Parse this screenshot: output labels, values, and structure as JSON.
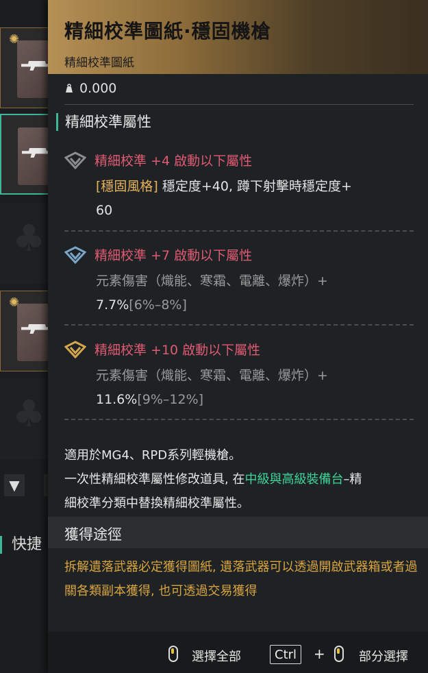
{
  "tooltip": {
    "title": "精細校準圖紙·穩固機槍",
    "subtitle": "精細校準圖紙",
    "weight": "0.000",
    "section_title": "精細校準屬性",
    "attributes": [
      {
        "icon": "calibration-emblem-grey-icon",
        "head": "精細校準 +4 啟動以下屬性",
        "tag": "[穩固風格]",
        "line1": " 穩定度+40, 蹲下射擊時穩定度+",
        "line2": "60",
        "range": ""
      },
      {
        "icon": "calibration-emblem-blue-icon",
        "head": "精細校準 +7 啟動以下屬性",
        "line1": "元素傷害（熾能、寒霜、電離、爆炸）+",
        "line2": "7.7%",
        "range": "[6%–8%]"
      },
      {
        "icon": "calibration-emblem-gold-icon",
        "head": "精細校準 +10 啟動以下屬性",
        "line1": "元素傷害（熾能、寒霜、電離、爆炸）+",
        "line2": "11.6%",
        "range": "[9%–12%]"
      }
    ],
    "usage": {
      "line1": "適用於MG4、RPD系列輕機槍。",
      "line2_pre": "一次性精細校準屬性修改道具, 在",
      "line2_green": "中級與高級裝備台",
      "line2_post": "–精",
      "line3": "細校準分類中替換精細校準屬性。"
    },
    "acquire_title": "獲得途徑",
    "acquire_text": "拆解遺落武器必定獲得圖紙, 遺落武器可以透過開啟武器箱或者過關各類副本獲得, 也可透過交易獲得"
  },
  "left_panel": {
    "quick_label": "快捷"
  },
  "footer": {
    "select_all": "選擇全部",
    "ctrl_key": "Ctrl",
    "plus": "+",
    "partial_select": "部分選擇"
  },
  "colors": {
    "accent_teal": "#3fb59a",
    "attr_pink": "#e05a73",
    "tag_gold": "#e6b35b",
    "green": "#3fd49a",
    "acquire_orange": "#d9a53f"
  }
}
